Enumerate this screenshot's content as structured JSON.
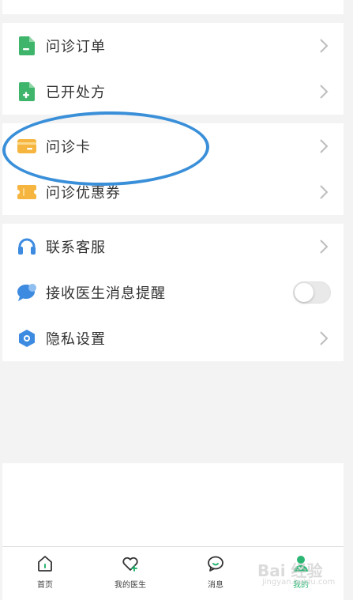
{
  "groups": [
    {
      "items": [
        {
          "label": "问诊订单",
          "icon": "document-minus-icon",
          "color": "#3fb56b"
        },
        {
          "label": "已开处方",
          "icon": "document-plus-icon",
          "color": "#3fb56b"
        }
      ]
    },
    {
      "items": [
        {
          "label": "问诊卡",
          "icon": "card-icon",
          "color": "#f5b53f"
        },
        {
          "label": "问诊优惠券",
          "icon": "coupon-icon",
          "color": "#f5b53f"
        }
      ]
    },
    {
      "items": [
        {
          "label": "联系客服",
          "icon": "headset-icon",
          "color": "#3d8be0"
        },
        {
          "label": "接收医生消息提醒",
          "icon": "chat-bubble-icon",
          "color": "#3d8be0",
          "toggle": false
        },
        {
          "label": "隐私设置",
          "icon": "privacy-settings-icon",
          "color": "#3d8be0"
        }
      ]
    }
  ],
  "tabbar": [
    {
      "label": "首页",
      "icon": "home-icon"
    },
    {
      "label": "我的医生",
      "icon": "heart-plus-icon"
    },
    {
      "label": "消息",
      "icon": "message-icon"
    },
    {
      "label": "我的",
      "icon": "user-icon",
      "active": true
    }
  ],
  "watermark": {
    "text": "Bai 经验",
    "sub": "jingyan.baidu.com"
  },
  "colors": {
    "green": "#3fb56b",
    "yellow": "#f5b53f",
    "blue": "#3d8be0",
    "annotation": "#3a8fd9",
    "active_tab": "#2bb673"
  }
}
